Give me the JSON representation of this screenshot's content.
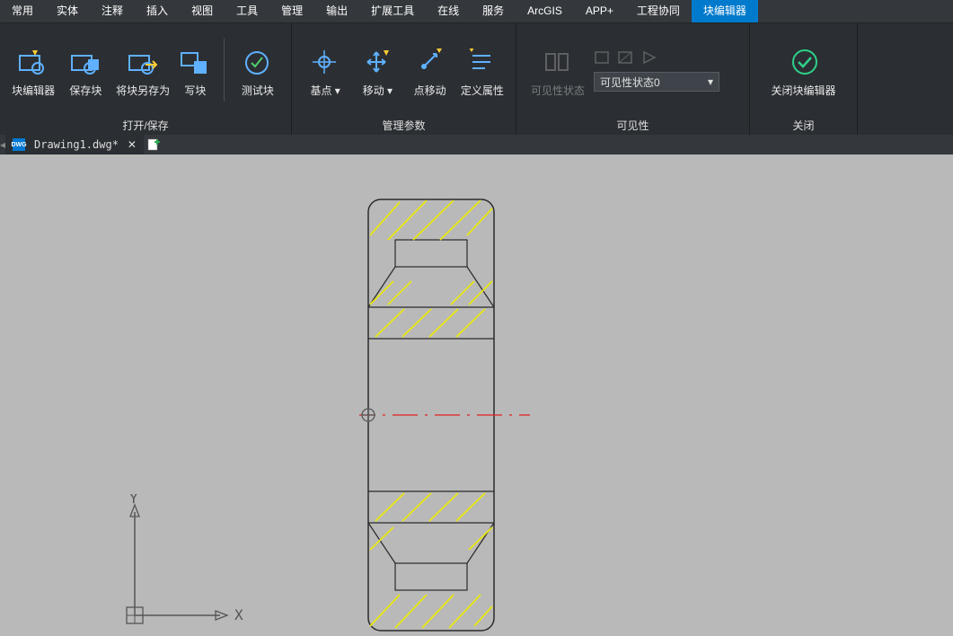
{
  "menu": {
    "items": [
      "常用",
      "实体",
      "注释",
      "插入",
      "视图",
      "工具",
      "管理",
      "输出",
      "扩展工具",
      "在线",
      "服务",
      "ArcGIS",
      "APP+",
      "工程协同",
      "块编辑器"
    ],
    "active_index": 14
  },
  "ribbon": {
    "panels": [
      {
        "title": "打开/保存",
        "buttons": [
          {
            "name": "block-editor",
            "label": "块编辑器"
          },
          {
            "name": "save-block",
            "label": "保存块"
          },
          {
            "name": "save-block-as",
            "label": "将块另存为"
          },
          {
            "name": "write-block",
            "label": "写块"
          },
          {
            "name": "test-block",
            "label": "测试块",
            "sep_before": true
          }
        ]
      },
      {
        "title": "管理参数",
        "buttons": [
          {
            "name": "basepoint",
            "label": "基点",
            "has_arrow": true
          },
          {
            "name": "move",
            "label": "移动",
            "has_arrow": true
          },
          {
            "name": "point-move",
            "label": "点移动"
          },
          {
            "name": "define-attr",
            "label": "定义属性"
          }
        ]
      },
      {
        "title": "可见性",
        "visibility": {
          "btn_label": "可见性状态",
          "combo_value": "可见性状态0"
        }
      },
      {
        "title": "关闭",
        "buttons": [
          {
            "name": "close-block-editor",
            "label": "关闭块编辑器"
          }
        ]
      }
    ]
  },
  "tabs": {
    "active_doc": "Drawing1.dwg*"
  },
  "ucs": {
    "x": "X",
    "y": "Y"
  }
}
